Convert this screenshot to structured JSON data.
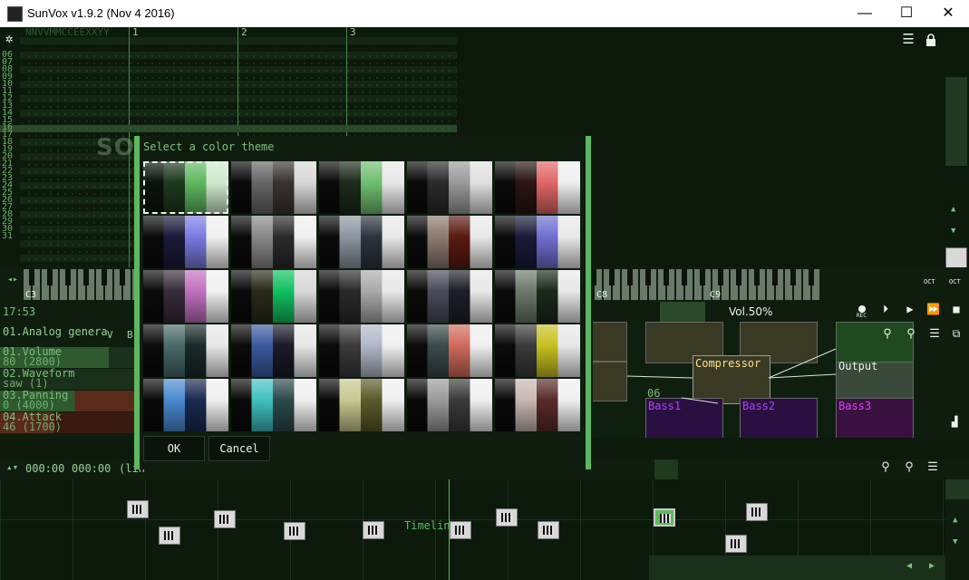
{
  "window": {
    "title": "SunVox v1.9.2 (Nov  4 2016)",
    "minimize": "—",
    "maximize": "☐",
    "close": "✕"
  },
  "pattern": {
    "header": "NNVVMMCCEEXXYY",
    "tracks": [
      "1",
      "2",
      "3"
    ],
    "rows": [
      "06",
      "07",
      "08",
      "09",
      "10",
      "11",
      "12",
      "13",
      "14",
      "15",
      "16",
      "17",
      "18",
      "19",
      "20",
      "21",
      "22",
      "23",
      "24",
      "25",
      "26",
      "27",
      "28",
      "29",
      "30",
      "31"
    ]
  },
  "keyboard": {
    "labels": [
      "C3",
      "C8",
      "C9"
    ],
    "oct_down": "OCT",
    "oct_up": "OCT"
  },
  "transport": {
    "time": "17:53",
    "volume": "Vol.50%",
    "rec": "REC"
  },
  "module_panel": {
    "name": "01.Analog genera",
    "tabs": [
      "V",
      "B"
    ],
    "controllers": [
      {
        "name": "01.Volume",
        "value": "80 (2800)"
      },
      {
        "name": "02.Waveform",
        "value": "saw (1)"
      },
      {
        "name": "03.Panning",
        "value": "0 (4000)"
      },
      {
        "name": "04.Attack",
        "value": "46 (1700)"
      }
    ]
  },
  "modules": {
    "compressor": "Compressor",
    "output": "Output",
    "bass1": "Bass1",
    "bass2": "Bass2",
    "bass3": "Bass3",
    "num06": "06"
  },
  "timeline": {
    "position": "000:00",
    "length": "000:00",
    "suffix": "(lin",
    "label": "Timeline"
  },
  "dialog": {
    "title": "Select a color theme",
    "ok": "OK",
    "cancel": "Cancel",
    "selected_index": 0,
    "themes": [
      [
        "#0a140a",
        "#1e3a1e",
        "#5fb85f",
        "#cfe8cf"
      ],
      [
        "#0a0a0a",
        "#666666",
        "#3a3430",
        "#d8d8d8"
      ],
      [
        "#0a0a0a",
        "#1c2b1c",
        "#6fbf6f",
        "#e8e8e8"
      ],
      [
        "#0a0a0a",
        "#2a2a2a",
        "#9a9a9a",
        "#e0e0e0"
      ],
      [
        "#0a0a0a",
        "#2a1414",
        "#e06666",
        "#f0f0f0"
      ],
      [
        "#0a0a0a",
        "#1a1a3a",
        "#7a7ae0",
        "#f0f0f0"
      ],
      [
        "#0a0a0a",
        "#888888",
        "#2a2a2a",
        "#f0f0f0"
      ],
      [
        "#0a0a0a",
        "#8a96a0",
        "#2c3440",
        "#e8e8e8"
      ],
      [
        "#0a0a0a",
        "#8a7a70",
        "#5a1a10",
        "#e8e8e8"
      ],
      [
        "#0a0a0a",
        "#1a1a3a",
        "#6f6fd0",
        "#e8e8e8"
      ],
      [
        "#0a0a0a",
        "#3a2a3a",
        "#c070c0",
        "#f0f0f0"
      ],
      [
        "#0a0a0a",
        "#2a2a1a",
        "#10c060",
        "#d8d8d8"
      ],
      [
        "#0a0a0a",
        "#2a2a2a",
        "#aaaaaa",
        "#e8e8e8"
      ],
      [
        "#0a0a0a",
        "#4a4a5a",
        "#1e1e2a",
        "#e8e8e8"
      ],
      [
        "#0a0a0a",
        "#6a7a6a",
        "#1a2a1a",
        "#e8e8e8"
      ],
      [
        "#0a0a0a",
        "#4a6a6a",
        "#1a2a2a",
        "#e8e8e8"
      ],
      [
        "#0a0a0a",
        "#3a5aa0",
        "#1a1a2a",
        "#e8e8e8"
      ],
      [
        "#0a0a0a",
        "#3a3a3a",
        "#b0b8c8",
        "#f0f0f0"
      ],
      [
        "#0a0a0a",
        "#3a4a4a",
        "#d06a5a",
        "#f0f0f0"
      ],
      [
        "#0a0a0a",
        "#3a3a3a",
        "#c8c020",
        "#e8e8e8"
      ],
      [
        "#0a0a0a",
        "#4a8ad0",
        "#1a2a50",
        "#f0f0f0"
      ],
      [
        "#0a0a0a",
        "#40c0c0",
        "#2a4a4a",
        "#f0f0f0"
      ],
      [
        "#0a0a0a",
        "#c8c890",
        "#5a5a2a",
        "#f0f0f0"
      ],
      [
        "#0a0a0a",
        "#9a9a9a",
        "#3a3a3a",
        "#f0f0f0"
      ],
      [
        "#0a0a0a",
        "#c8b8b0",
        "#5a2a2a",
        "#f0f0f0"
      ]
    ]
  },
  "watermark": "SOFTPEDIA",
  "colors": {
    "accent": "#5fb85f",
    "bg": "#0b1a0b",
    "module_purple": "#a020f0",
    "module_olive": "#3a3a24"
  },
  "icons": [
    "app-icon",
    "menu-icon",
    "lock-icon",
    "rec-icon",
    "play-icon",
    "play-from-start-icon",
    "play-pattern-icon",
    "stop-icon",
    "scroll-up-icon",
    "scroll-down-icon",
    "link-icon",
    "zoom-icon"
  ]
}
